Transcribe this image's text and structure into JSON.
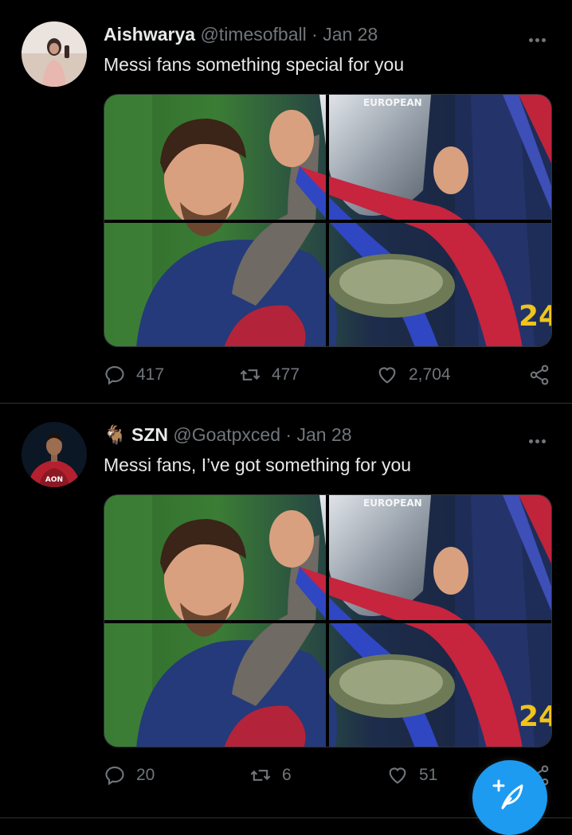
{
  "tweets": [
    {
      "name": "Aishwarya",
      "handle": "@timesofball",
      "sep": "·",
      "date": "Jan 28",
      "text": "Messi fans something special for you",
      "image_text": "EUROPEAN",
      "replies": "417",
      "retweets": "477",
      "likes": "2,704"
    },
    {
      "name": "SZN",
      "name_emoji": "🐐",
      "handle": "@Goatpxced",
      "sep": "·",
      "date": "Jan 28",
      "text": "Messi fans, I’ve got something for you",
      "avatar_text": "AON",
      "image_text": "EUROPEAN",
      "replies": "20",
      "retweets": "6",
      "likes": "51"
    }
  ],
  "colors": {
    "accent": "#1d9bf0",
    "muted": "#71767b",
    "text": "#e7e9ea",
    "divider": "#2f3336"
  },
  "icons": [
    "more-icon",
    "reply-icon",
    "retweet-icon",
    "like-icon",
    "share-icon",
    "compose-icon"
  ]
}
